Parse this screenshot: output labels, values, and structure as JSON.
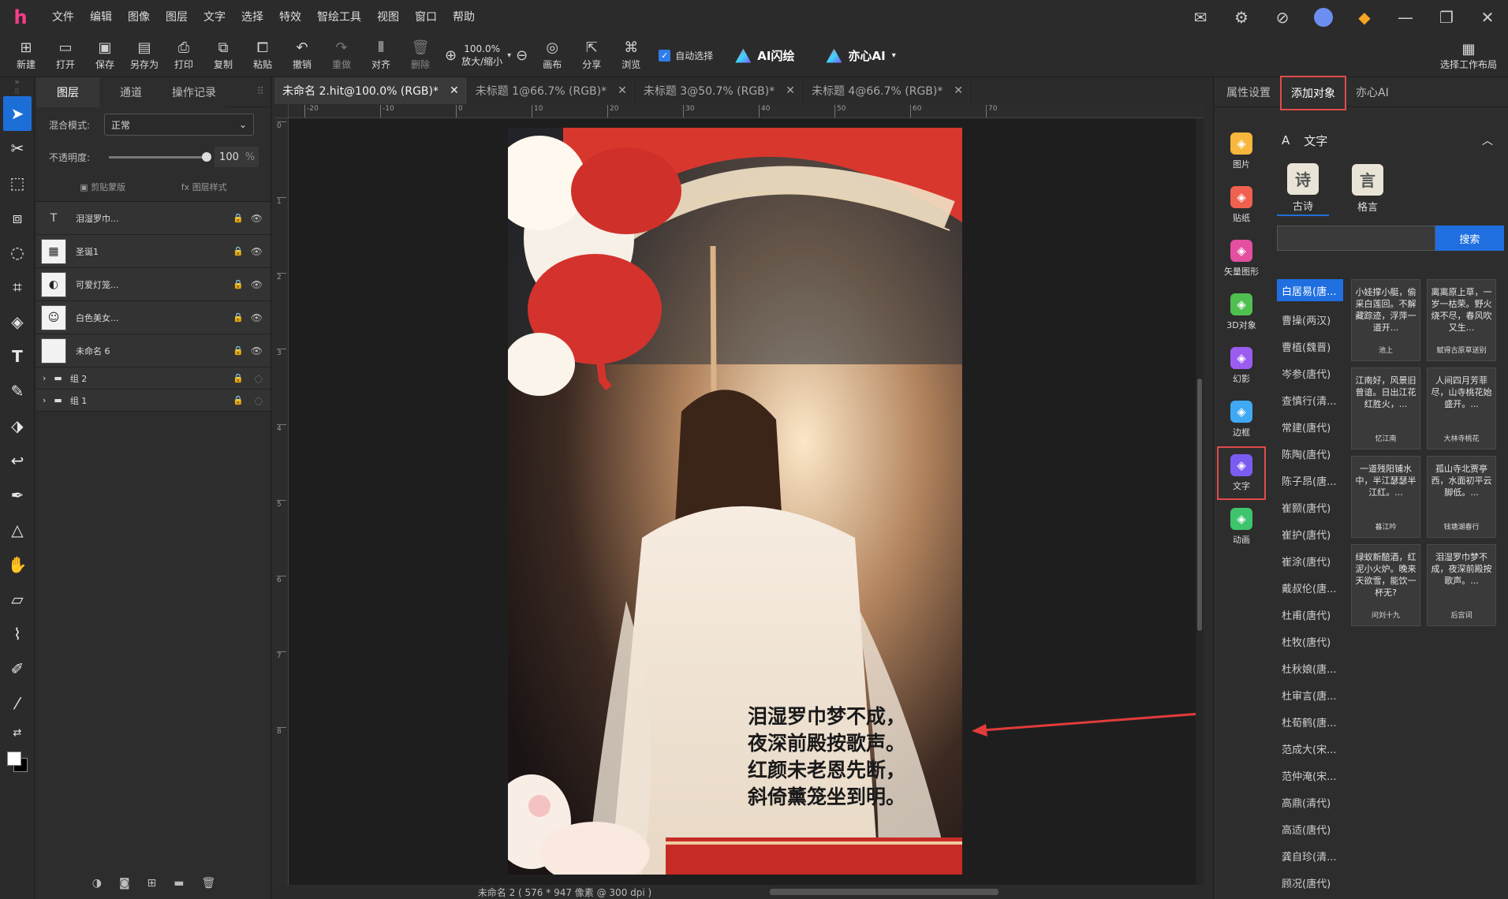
{
  "app": {
    "logo": "h",
    "title": "Hit Image Editor"
  },
  "menu": [
    "文件",
    "编辑",
    "图像",
    "图层",
    "文字",
    "选择",
    "特效",
    "智绘工具",
    "视图",
    "窗口",
    "帮助"
  ],
  "toolbar": {
    "new": "新建",
    "open": "打开",
    "save": "保存",
    "save_as": "另存为",
    "print": "打印",
    "copy": "复制",
    "paste": "粘贴",
    "undo": "撤销",
    "redo": "重做",
    "align": "对齐",
    "delete": "删除",
    "zoom_value": "100.0%",
    "zoom_label": "放大/缩小",
    "canvas": "画布",
    "share": "分享",
    "browse": "浏览",
    "auto_select": "自动选择",
    "ai_flash": "AI闪绘",
    "ai_yixin": "亦心AI",
    "workspace": "选择工作布局"
  },
  "layers_panel": {
    "tabs": [
      "图层",
      "通道",
      "操作记录"
    ],
    "blend_label": "混合模式:",
    "blend_value": "正常",
    "opacity_label": "不透明度:",
    "opacity_value": "100",
    "opacity_unit": "%",
    "opacity_fraction": 1.0,
    "clip_mask": "剪贴蒙版",
    "layer_style": "图层样式",
    "layers": [
      {
        "name": "泪湿罗巾...",
        "type": "text",
        "thumb": "T"
      },
      {
        "name": "圣诞1",
        "type": "image",
        "thumb": "▦"
      },
      {
        "name": "可爱灯笼...",
        "type": "image",
        "thumb": "◐"
      },
      {
        "name": "白色美女...",
        "type": "image",
        "thumb": "☺"
      },
      {
        "name": "未命名 6",
        "type": "image",
        "thumb": ""
      }
    ],
    "groups": [
      {
        "name": "组 2"
      },
      {
        "name": "组 1"
      }
    ]
  },
  "doc_tabs": [
    {
      "label": "未命名 2.hit@100.0% (RGB)*",
      "active": true
    },
    {
      "label": "未标题 1@66.7% (RGB)*",
      "active": false
    },
    {
      "label": "未标题 3@50.7% (RGB)*",
      "active": false
    },
    {
      "label": "未标题 4@66.7% (RGB)*",
      "active": false
    }
  ],
  "ruler": {
    "top_labels": [
      "-20",
      "-10",
      "0",
      "10",
      "20",
      "30",
      "40",
      "50",
      "60",
      "70"
    ],
    "left_labels": [
      "0",
      "1",
      "2",
      "3",
      "4",
      "5",
      "6",
      "7",
      "8"
    ]
  },
  "canvas": {
    "poem_lines": [
      "泪湿罗巾梦不成，",
      "夜深前殿按歌声。",
      "红颜未老恩先断，",
      "斜倚薰笼坐到明。"
    ],
    "status": "未命名 2 ( 576 * 947 像素 @ 300 dpi )"
  },
  "right_panel": {
    "tabs": [
      "属性设置",
      "添加对象",
      "亦心AI"
    ],
    "categories": [
      {
        "label": "图片",
        "icon": "image-icon",
        "color": "#f6b73c"
      },
      {
        "label": "贴纸",
        "icon": "sticker-icon",
        "color": "#f0604f"
      },
      {
        "label": "矢量图形",
        "icon": "vector-icon",
        "color": "#e44fa0"
      },
      {
        "label": "3D对象",
        "icon": "cube-icon",
        "color": "#4fc04f"
      },
      {
        "label": "幻影",
        "icon": "phantom-icon",
        "color": "#9b5cf0"
      },
      {
        "label": "边框",
        "icon": "frame-icon",
        "color": "#3fa9f5"
      },
      {
        "label": "文字",
        "icon": "text-icon",
        "color": "#7b5cf0"
      },
      {
        "label": "动画",
        "icon": "animation-icon",
        "color": "#3ec46d"
      }
    ],
    "text_section": {
      "title": "文字",
      "types": [
        "古诗",
        "格言"
      ],
      "search_placeholder": "",
      "search_button": "搜索"
    },
    "poets": [
      "白居易(唐...",
      "曹操(两汉)",
      "曹植(魏晋)",
      "岑参(唐代)",
      "查慎行(清...",
      "常建(唐代)",
      "陈陶(唐代)",
      "陈子昂(唐...",
      "崔颢(唐代)",
      "崔护(唐代)",
      "崔涂(唐代)",
      "戴叔伦(唐...",
      "杜甫(唐代)",
      "杜牧(唐代)",
      "杜秋娘(唐...",
      "杜审言(唐...",
      "杜荀鹤(唐...",
      "范成大(宋...",
      "范仲淹(宋...",
      "高鼎(清代)",
      "高适(唐代)",
      "龚自珍(清...",
      "顾况(唐代)"
    ],
    "poems": [
      {
        "text": "小娃撑小艇，偷采白莲回。不解藏踪迹，浮萍一道开...",
        "title": "池上"
      },
      {
        "text": "离离原上草，一岁一枯荣。野火烧不尽，春风吹又生...",
        "title": "赋得古原草送别"
      },
      {
        "text": "江南好，风景旧曾谙。日出江花红胜火，...",
        "title": "忆江南"
      },
      {
        "text": "人间四月芳菲尽，山寺桃花始盛开。...",
        "title": "大林寺桃花"
      },
      {
        "text": "一道残阳铺水中，半江瑟瑟半江红。...",
        "title": "暮江吟"
      },
      {
        "text": "孤山寺北贾亭西，水面初平云脚低。...",
        "title": "钱塘湖春行"
      },
      {
        "text": "绿蚁新醅酒，红泥小火炉。晚来天欲雪，能饮一杯无?",
        "title": "问刘十九"
      },
      {
        "text": "泪湿罗巾梦不成，夜深前殿按歌声。...",
        "title": "后宫词"
      }
    ]
  }
}
